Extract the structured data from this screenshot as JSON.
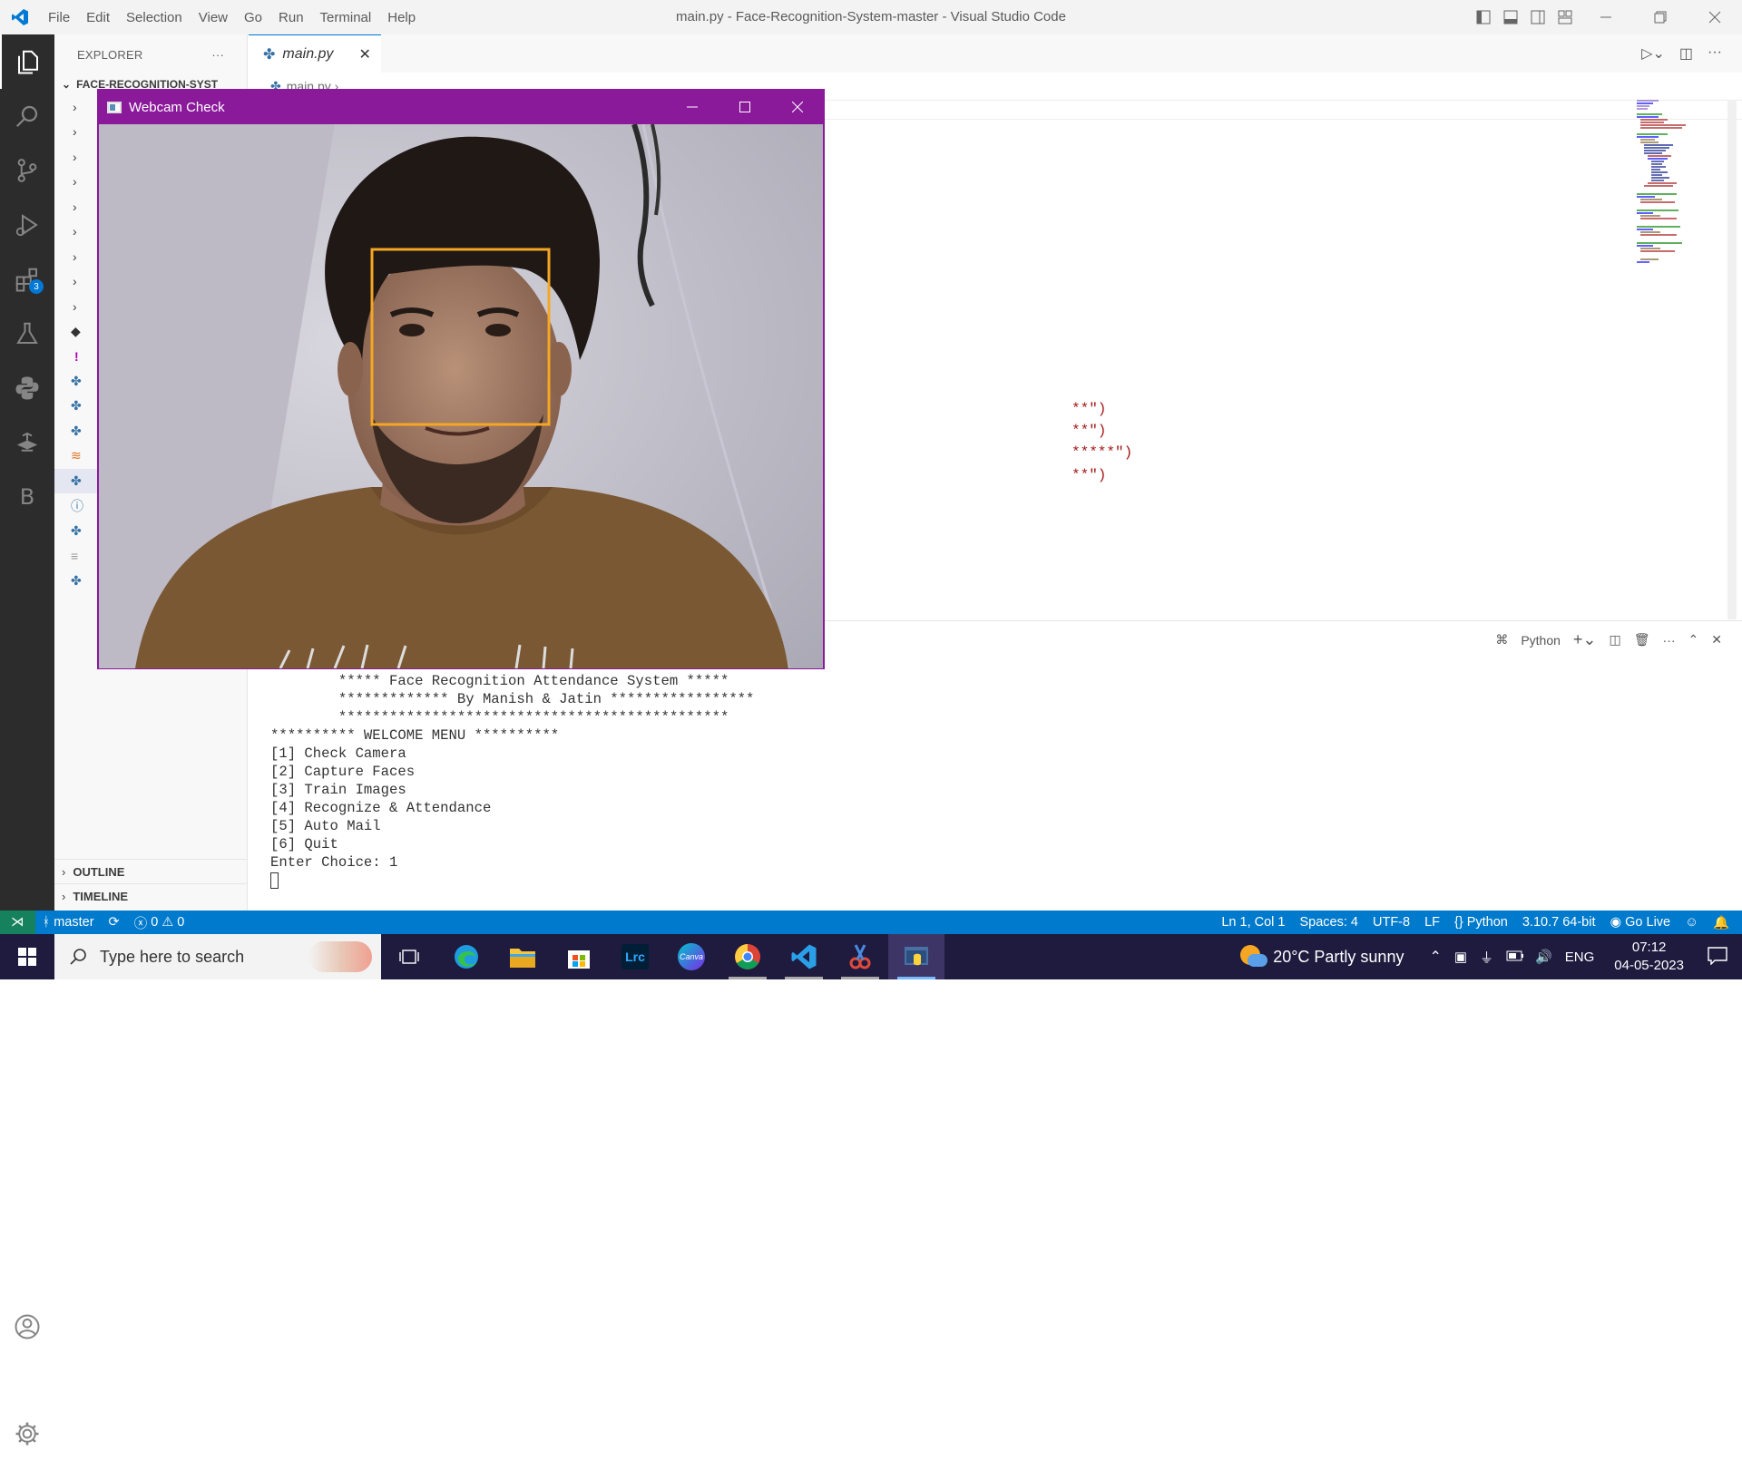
{
  "titlebar": {
    "menus": [
      "File",
      "Edit",
      "Selection",
      "View",
      "Go",
      "Run",
      "Terminal",
      "Help"
    ],
    "title": "main.py - Face-Recognition-System-master - Visual Studio Code"
  },
  "activity": {
    "extensions_badge": "3"
  },
  "sidebar": {
    "header": "EXPLORER",
    "folder": "FACE-RECOGNITION-SYST",
    "outline": "OUTLINE",
    "timeline": "TIMELINE"
  },
  "editor": {
    "tab_label": "main.py",
    "breadcrumb": "main.py",
    "code_fragments": [
      "**\")",
      "**\")",
      "*****\")",
      "**\")"
    ]
  },
  "panel": {
    "shell_label": "Python",
    "terminal_lines": [
      "        ***** Face Recognition Attendance System *****",
      "        ************* By Manish & Jatin *****************",
      "        **********************************************",
      "",
      "********** WELCOME MENU **********",
      "[1] Check Camera",
      "[2] Capture Faces",
      "[3] Train Images",
      "[4] Recognize & Attendance",
      "[5] Auto Mail",
      "[6] Quit",
      "Enter Choice: 1"
    ]
  },
  "webcam": {
    "title": "Webcam Check"
  },
  "statusbar": {
    "branch": "master",
    "errors": "0",
    "warnings": "0",
    "position": "Ln 1, Col 1",
    "spaces": "Spaces: 4",
    "encoding": "UTF-8",
    "eol": "LF",
    "language": "Python",
    "interpreter": "3.10.7 64-bit",
    "golive": "Go Live"
  },
  "taskbar": {
    "search_placeholder": "Type here to search",
    "weather": "20°C  Partly sunny",
    "lang": "ENG",
    "time": "07:12",
    "date": "04-05-2023"
  },
  "colors": {
    "accent": "#007acc",
    "webcam_title": "#8b1a9b",
    "face_box": "#f5a623"
  }
}
